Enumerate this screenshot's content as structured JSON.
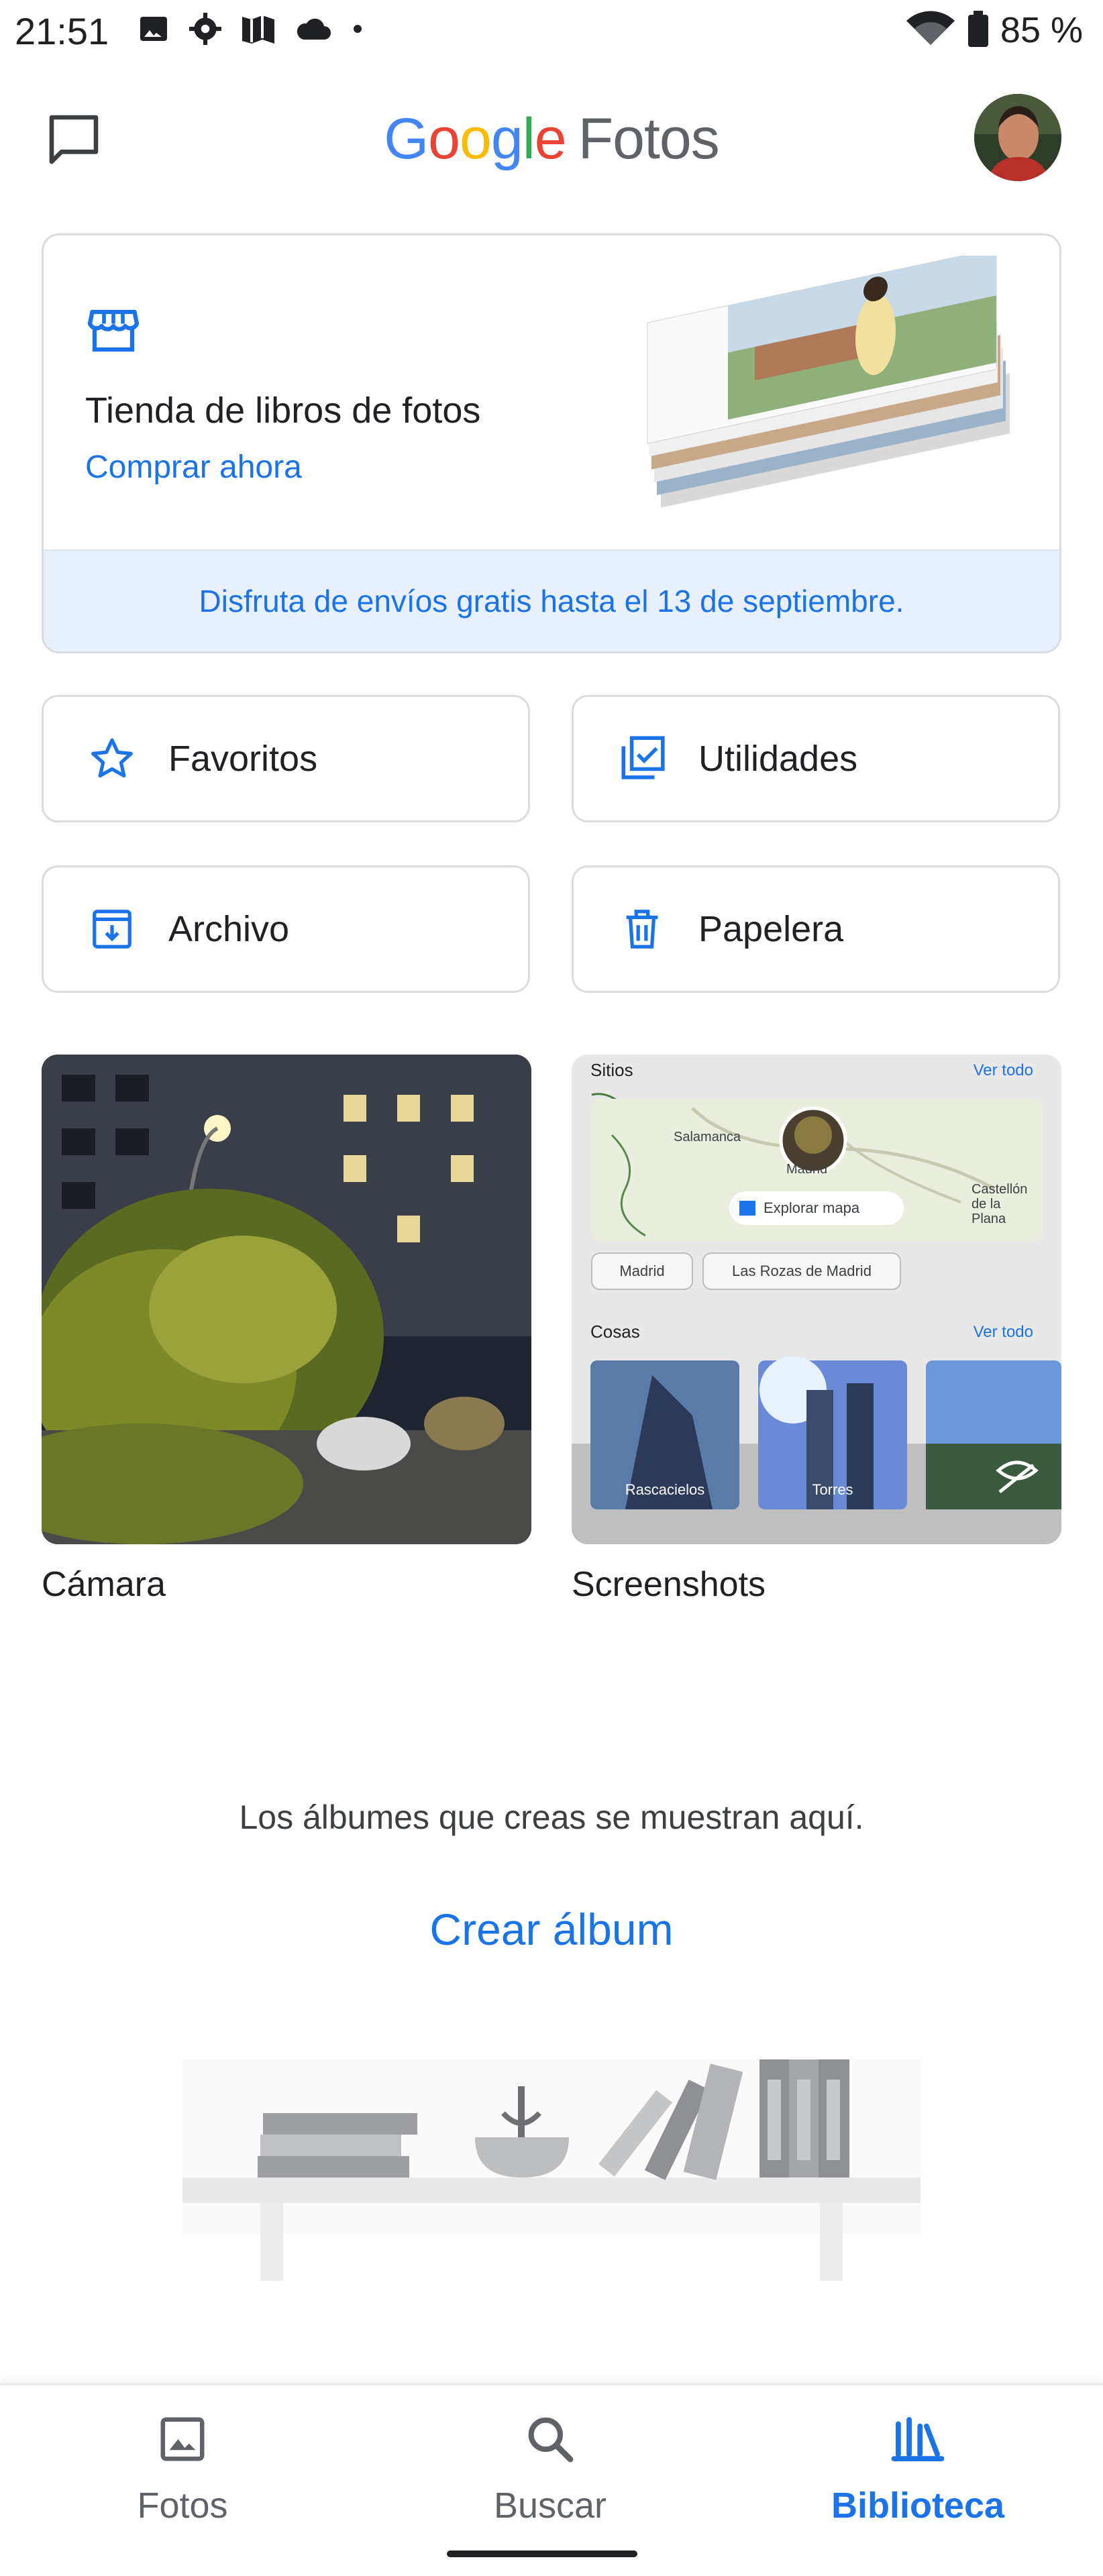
{
  "status_bar": {
    "time": "21:51",
    "battery": "85 %",
    "icons": [
      "image-icon",
      "settings-icon",
      "maps-icon",
      "cloud-icon",
      "dot-icon"
    ],
    "right_icons": [
      "wifi-icon",
      "battery-icon"
    ]
  },
  "header": {
    "logo_google": [
      "G",
      "o",
      "o",
      "g",
      "l",
      "e"
    ],
    "logo_product": "Fotos",
    "colors": {
      "blue": "#4285F4",
      "red": "#EA4335",
      "yellow": "#FBBC05",
      "green": "#34A853"
    }
  },
  "promo": {
    "title": "Tienda de libros de fotos",
    "link": "Comprar ahora",
    "banner": "Disfruta de envíos gratis hasta el 13 de septiembre.",
    "icon": "store-icon"
  },
  "quick_tiles": [
    {
      "label": "Favoritos",
      "icon": "star-icon"
    },
    {
      "label": "Utilidades",
      "icon": "checklist-icon"
    },
    {
      "label": "Archivo",
      "icon": "archive-icon"
    },
    {
      "label": "Papelera",
      "icon": "trash-icon"
    }
  ],
  "albums": [
    {
      "name": "Cámara"
    },
    {
      "name": "Screenshots"
    }
  ],
  "screenshot_preview": {
    "places_title": "Sitios",
    "see_all": "Ver todo",
    "map_labels": [
      "Salamanca",
      "Madrid",
      "Castellón de la Plana"
    ],
    "explore_map": "Explorar mapa",
    "chips": [
      "Madrid",
      "Las Rozas de Madrid"
    ],
    "things_title": "Cosas",
    "things": [
      "Rascacielos",
      "Torres"
    ]
  },
  "empty_state": {
    "text": "Los álbumes que creas se muestran aquí.",
    "create": "Crear álbum"
  },
  "bottom_nav": [
    {
      "label": "Fotos",
      "icon": "photo-icon",
      "active": false
    },
    {
      "label": "Buscar",
      "icon": "search-icon",
      "active": false
    },
    {
      "label": "Biblioteca",
      "icon": "library-icon",
      "active": true
    }
  ],
  "accent_color": "#1a73e8"
}
